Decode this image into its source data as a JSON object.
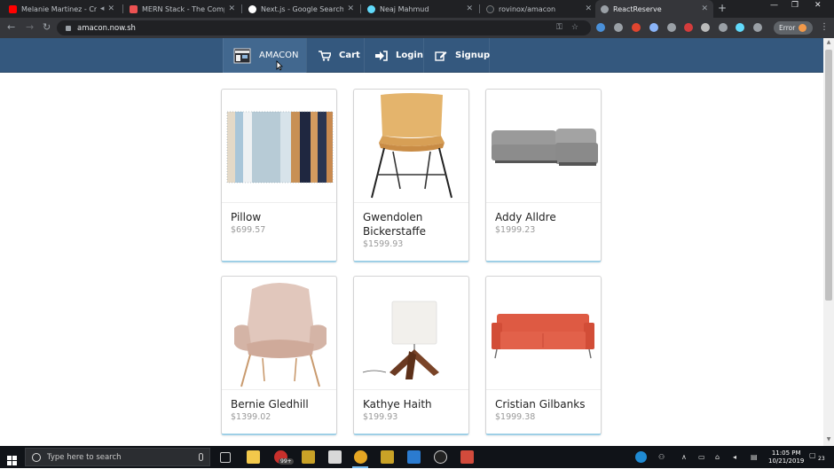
{
  "browser": {
    "tabs": [
      {
        "label": "Melanie Martinez - Cry B",
        "favicon_color": "#ff0000",
        "active": false
      },
      {
        "label": "MERN Stack - The Complete",
        "favicon_color": "#ec5252",
        "active": false
      },
      {
        "label": "Next.js - Google Search",
        "favicon_color": "#ffffff",
        "active": false
      },
      {
        "label": "Neaj Mahmud",
        "favicon_color": "#3b5998",
        "active": false
      },
      {
        "label": "rovinox/amacon",
        "favicon_color": "#24292e",
        "active": false
      },
      {
        "label": "ReactReserve",
        "favicon_color": "#9aa0a6",
        "active": true
      }
    ],
    "url": "amacon.now.sh",
    "error_label": "Error"
  },
  "nav": {
    "brand": "AMACON",
    "cart": "Cart",
    "login": "Login",
    "signup": "Signup"
  },
  "products": [
    {
      "name": "Pillow",
      "price": "$699.57",
      "image": "striped-rug"
    },
    {
      "name": "Gwendolen Bickerstaffe",
      "price": "$1599.93",
      "image": "mustard-chair"
    },
    {
      "name": "Addy Alldre",
      "price": "$1999.23",
      "image": "grey-sectional-sofa"
    },
    {
      "name": "Bernie Gledhill",
      "price": "$1399.02",
      "image": "pink-lounge-chair"
    },
    {
      "name": "Kathye Haith",
      "price": "$199.93",
      "image": "wood-table-lamp"
    },
    {
      "name": "Cristian Gilbanks",
      "price": "$1999.38",
      "image": "orange-sofa"
    }
  ],
  "taskbar": {
    "search_placeholder": "Type here to search",
    "time": "11:05 PM",
    "date": "10/21/2019",
    "badge": "99+",
    "notification_count": "23"
  },
  "colors": {
    "nav_bg": "#34587e",
    "brand_bg": "#42688f",
    "card_accent": "#9ecfe6"
  }
}
